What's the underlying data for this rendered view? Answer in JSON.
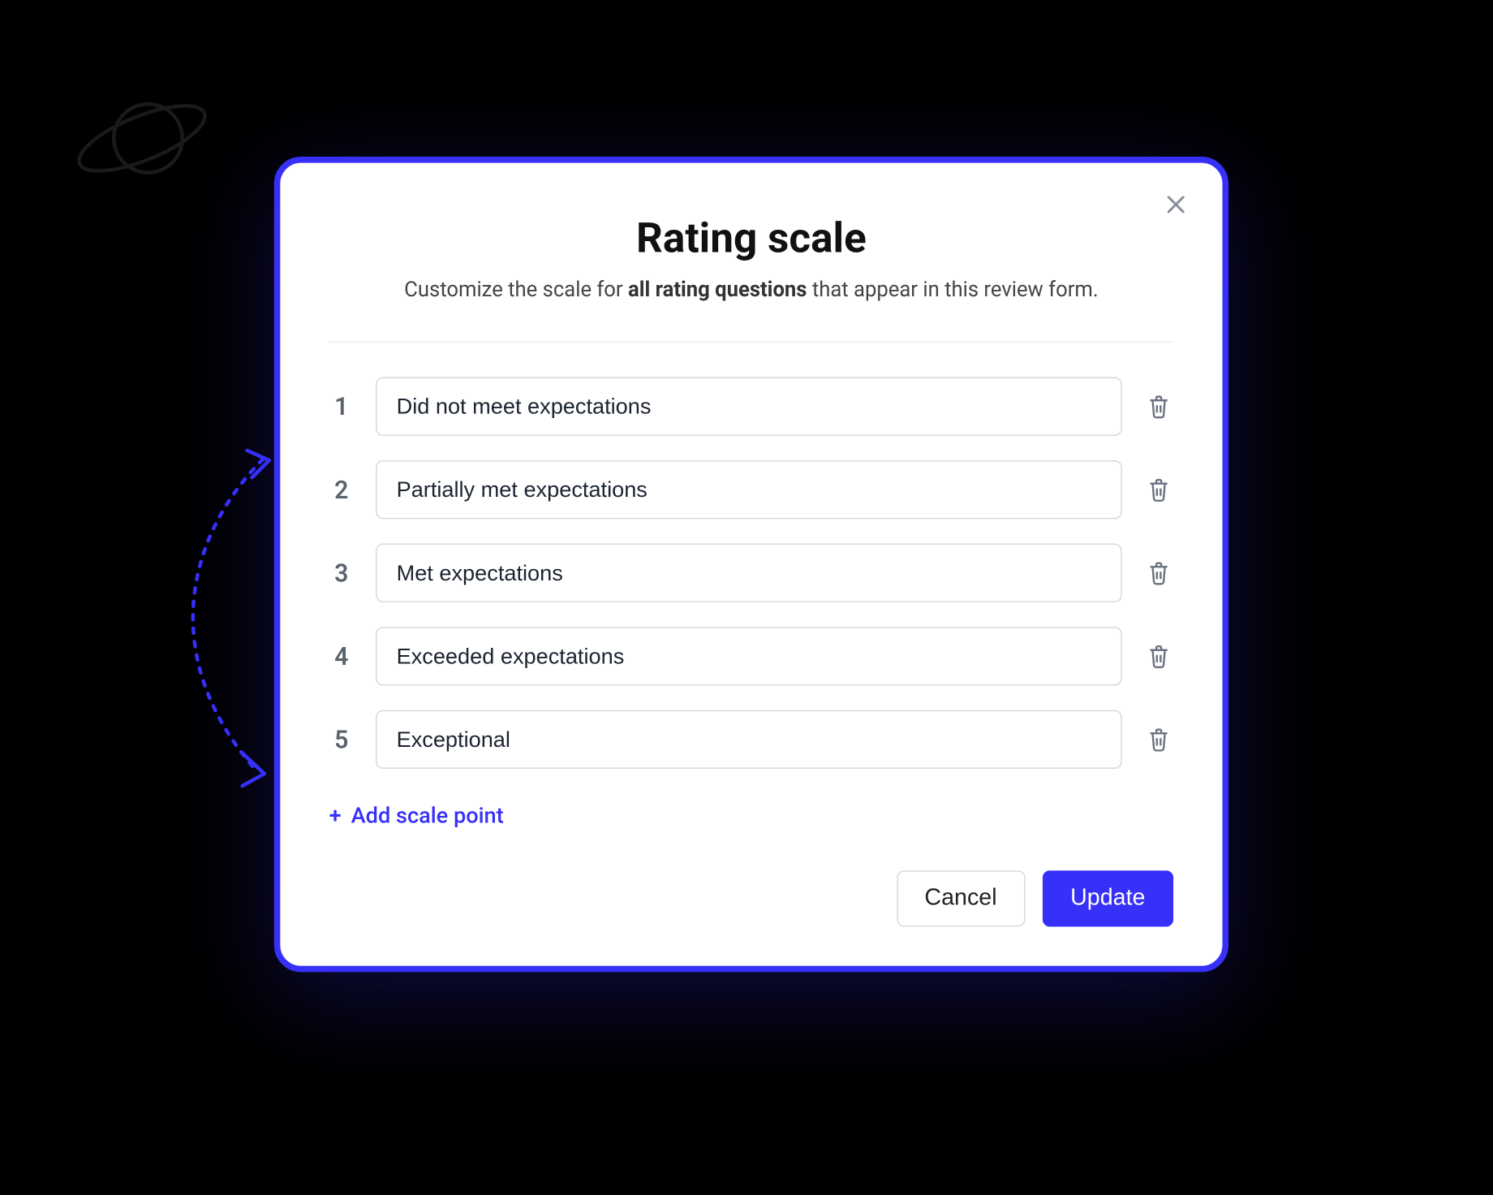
{
  "colors": {
    "accent": "#3730f8"
  },
  "modal": {
    "title": "Rating scale",
    "subtitle_pre": "Customize the scale for ",
    "subtitle_bold": "all rating questions",
    "subtitle_post": " that appear in this review form.",
    "add_label": "Add scale point",
    "cancel_label": "Cancel",
    "update_label": "Update",
    "scale_items": [
      {
        "num": "1",
        "value": "Did not meet expectations"
      },
      {
        "num": "2",
        "value": "Partially met expectations"
      },
      {
        "num": "3",
        "value": "Met expectations"
      },
      {
        "num": "4",
        "value": "Exceeded expectations"
      },
      {
        "num": "5",
        "value": "Exceptional"
      }
    ]
  }
}
